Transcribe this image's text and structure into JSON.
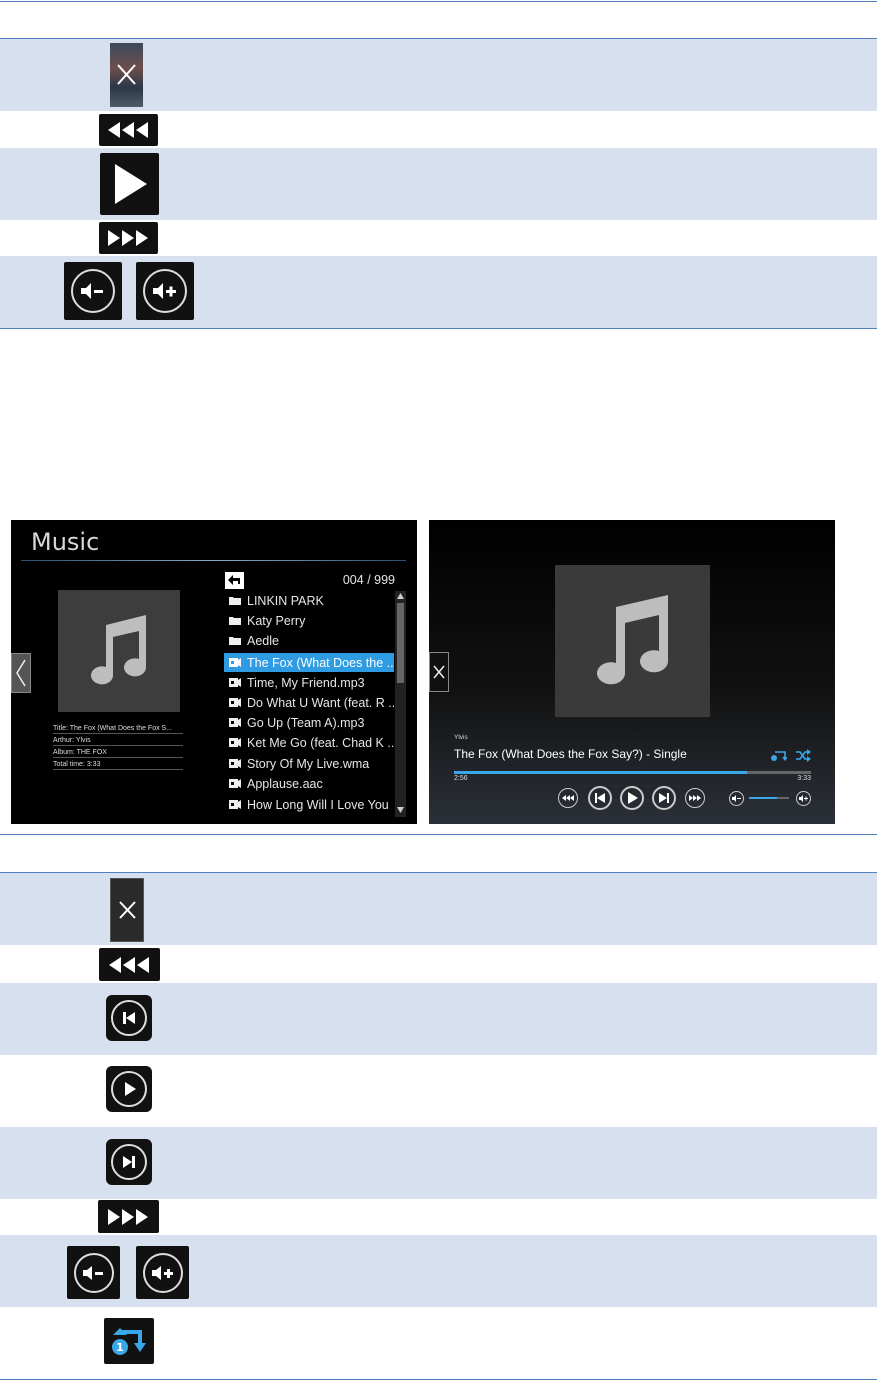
{
  "music_screen": {
    "title": "Music",
    "counter": "004 / 999",
    "info": [
      "Title: The Fox (What Does the Fox S...",
      "Arthur: Ylvis",
      "Album: THE FOX",
      "Total time: 3:33"
    ],
    "items": [
      {
        "label": "LINKIN PARK",
        "icon": "folder-icon",
        "selected": false
      },
      {
        "label": "Katy Perry",
        "icon": "folder-icon",
        "selected": false
      },
      {
        "label": "Aedle",
        "icon": "folder-icon",
        "selected": false
      },
      {
        "label": "The Fox (What Does the ...",
        "icon": "audio-file-icon",
        "selected": true
      },
      {
        "label": "Time, My Friend.mp3",
        "icon": "audio-file-icon",
        "selected": false
      },
      {
        "label": "Do What U Want (feat. R ...",
        "icon": "audio-file-icon",
        "selected": false
      },
      {
        "label": "Go Up (Team A).mp3",
        "icon": "audio-file-icon",
        "selected": false
      },
      {
        "label": "Ket Me Go (feat. Chad K ...",
        "icon": "audio-file-icon",
        "selected": false
      },
      {
        "label": "Story Of My Live.wma",
        "icon": "audio-file-icon",
        "selected": false
      },
      {
        "label": "Applause.aac",
        "icon": "audio-file-icon",
        "selected": false
      },
      {
        "label": "How Long Will I Love You",
        "icon": "audio-file-icon",
        "selected": false
      }
    ]
  },
  "player_screen": {
    "artist": "Ylvis",
    "track": "The Fox (What Does the Fox Say?) - Single",
    "elapsed": "2:56",
    "total": "3:33",
    "progress_fraction": 0.82,
    "volume_fraction": 0.7
  },
  "colors": {
    "rule": "#4f81bd",
    "band": "#d6e0ee",
    "accent": "#2f9be3"
  }
}
